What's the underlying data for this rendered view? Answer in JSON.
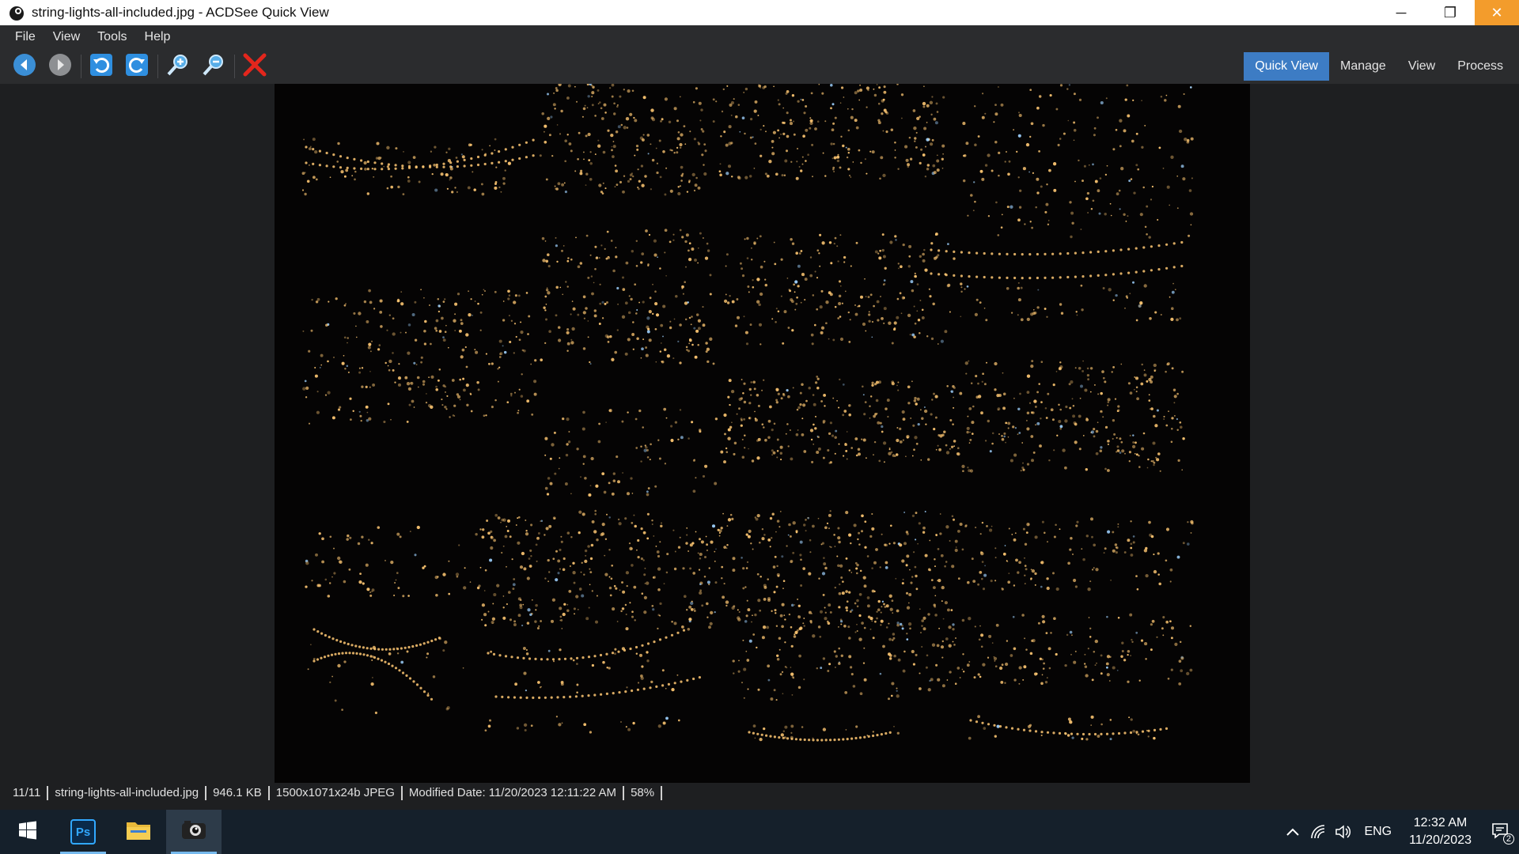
{
  "window": {
    "title": "string-lights-all-included.jpg - ACDSee Quick View",
    "minimize_glyph": "─",
    "restore_glyph": "❐",
    "close_glyph": "✕"
  },
  "menu": [
    {
      "label": "File"
    },
    {
      "label": "View"
    },
    {
      "label": "Tools"
    },
    {
      "label": "Help"
    }
  ],
  "toolbar": {
    "icons": [
      "back-icon",
      "forward-icon",
      "rotate-left-icon",
      "rotate-right-icon",
      "zoom-in-icon",
      "zoom-out-icon",
      "delete-icon"
    ]
  },
  "modes": [
    {
      "label": "Quick View",
      "active": true
    },
    {
      "label": "Manage",
      "active": false
    },
    {
      "label": "View",
      "active": false
    },
    {
      "label": "Process",
      "active": false
    }
  ],
  "status": {
    "index": "11/11",
    "filename": "string-lights-all-included.jpg",
    "filesize": "946.1 KB",
    "dimensions": "1500x1071x24b JPEG",
    "modified": "Modified Date: 11/20/2023 12:11:22 AM",
    "zoom": "58%"
  },
  "taskbar": {
    "apps": [
      "windows-start-icon",
      "photoshop-icon",
      "file-explorer-icon",
      "acdsee-icon"
    ],
    "photoshop_label": "Ps",
    "language": "ENG",
    "time": "12:32 AM",
    "date": "11/20/2023",
    "notification_count": "2"
  },
  "colors": {
    "accent": "#3d7cc4",
    "close_button": "#f39c2c",
    "light_warm": "#ffc873",
    "light_blue": "#9fd2ff"
  }
}
